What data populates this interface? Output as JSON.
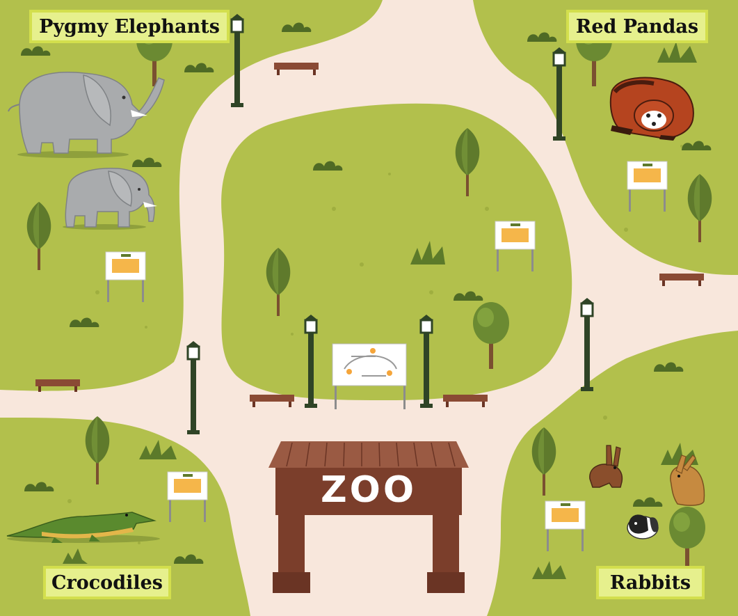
{
  "enclosures": {
    "elephants": {
      "label": "Pygmy Elephants"
    },
    "red_pandas": {
      "label": "Red Pandas"
    },
    "crocodiles": {
      "label": "Crocodiles"
    },
    "rabbits": {
      "label": "Rabbits"
    }
  },
  "entrance": {
    "sign": "ZOO"
  },
  "colors": {
    "grass": "#b2c04c",
    "path": "#f8e7dc",
    "tree_dark": "#5f7a2c",
    "tree_light": "#7d9c3d",
    "lamp": "#2f4426",
    "gate_wood": "#7b3e2b",
    "gate_roof": "#9a5a43",
    "label_bg": "#e6f08d",
    "label_border": "#d3df4d"
  }
}
